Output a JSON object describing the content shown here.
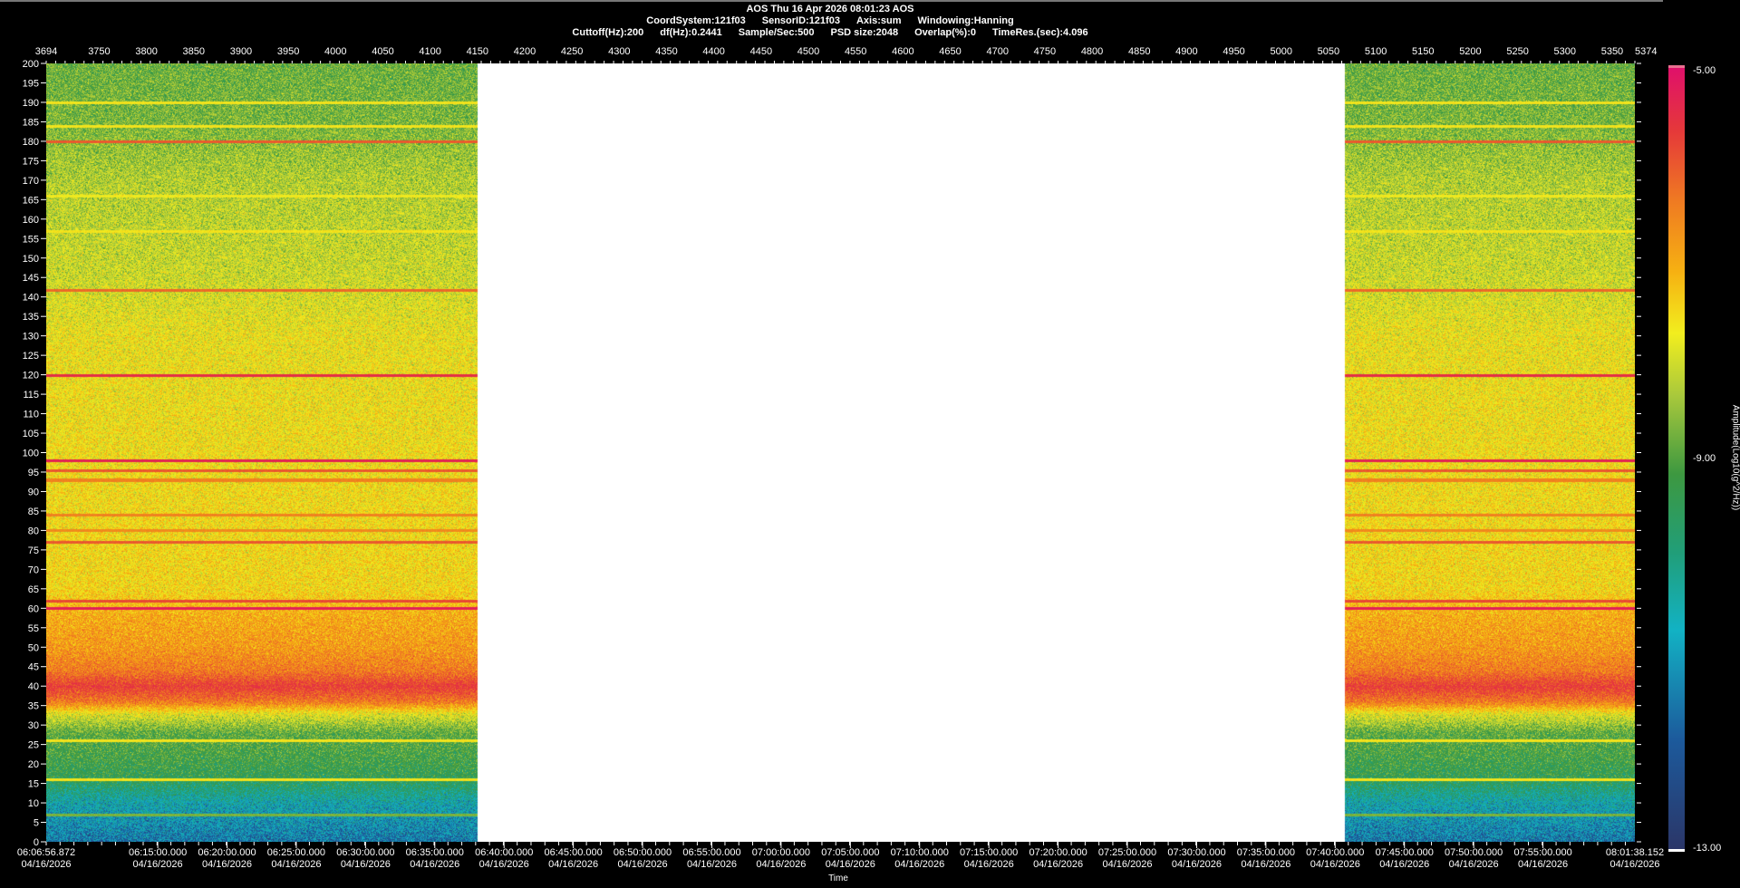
{
  "header": {
    "line1": "AOS  Thu 16 Apr 2026 08:01:23  AOS",
    "line2": [
      "CoordSystem:121f03",
      "SensorID:121f03",
      "Axis:sum",
      "Windowing:Hanning"
    ],
    "line3": [
      "Cuttoff(Hz):200",
      "df(Hz):0.2441",
      "Sample/Sec:500",
      "PSD size:2048",
      "Overlap(%):0",
      "TimeRes.(sec):4.096"
    ]
  },
  "chart_data": {
    "type": "heatmap",
    "title": "AOS  Thu 16 Apr 2026 08:01:23  AOS",
    "xlabel": "Time",
    "ylabel": "",
    "colorbar_label": "Amplitude(Log10(g^2/Hz))",
    "colorbar_range": [
      -13,
      -5
    ],
    "colorbar_ticks": [
      "-5.00",
      "-9.00",
      "-13.00"
    ],
    "y_range": [
      0,
      200
    ],
    "y_step": 5,
    "x_time_range_sec": [
      0,
      6881.28
    ],
    "x_start_label": [
      "06:06:56.872",
      "04/16/2026"
    ],
    "x_end_label": [
      "08:01:38.152",
      "04/16/2026"
    ],
    "x_tick_times": [
      "06:15:00.000",
      "06:20:00.000",
      "06:25:00.000",
      "06:30:00.000",
      "06:35:00.000",
      "06:40:00.000",
      "06:45:00.000",
      "06:50:00.000",
      "06:55:00.000",
      "07:00:00.000",
      "07:05:00.000",
      "07:10:00.000",
      "07:15:00.000",
      "07:20:00.000",
      "07:25:00.000",
      "07:30:00.000",
      "07:35:00.000",
      "07:40:00.000",
      "07:45:00.000",
      "07:50:00.000",
      "07:55:00.000"
    ],
    "x_tick_date": "04/16/2026",
    "top_axis_range": [
      3694,
      5374
    ],
    "top_axis_ticks": [
      3694,
      3750,
      3800,
      3850,
      3900,
      3950,
      4000,
      4050,
      4100,
      4150,
      4200,
      4250,
      4300,
      4350,
      4400,
      4450,
      4500,
      4550,
      4600,
      4650,
      4700,
      4750,
      4800,
      4850,
      4900,
      4950,
      5000,
      5050,
      5100,
      5150,
      5200,
      5250,
      5300,
      5350,
      5374
    ],
    "data_gap_sec": [
      1865,
      5625
    ],
    "mean_level_profile": [
      [
        0,
        -11.8
      ],
      [
        5,
        -11.5
      ],
      [
        10,
        -11.2
      ],
      [
        14,
        -10.6
      ],
      [
        17,
        -10.2
      ],
      [
        22,
        -10.0
      ],
      [
        28,
        -9.8
      ],
      [
        33,
        -8.8
      ],
      [
        36,
        -7.4
      ],
      [
        40,
        -6.6
      ],
      [
        44,
        -7.4
      ],
      [
        50,
        -7.8
      ],
      [
        58,
        -8.0
      ],
      [
        65,
        -8.5
      ],
      [
        100,
        -8.6
      ],
      [
        130,
        -8.7
      ],
      [
        145,
        -9.0
      ],
      [
        170,
        -9.2
      ],
      [
        185,
        -9.6
      ],
      [
        200,
        -9.7
      ]
    ],
    "harmonic_lines": [
      [
        190,
        -8.6
      ],
      [
        184,
        -8.6
      ],
      [
        180,
        -7.0
      ],
      [
        166,
        -8.7
      ],
      [
        157,
        -8.6
      ],
      [
        141.7,
        -7.2
      ],
      [
        120,
        -6.2
      ],
      [
        98,
        -5.8
      ],
      [
        95.5,
        -7.0
      ],
      [
        93,
        -7.5
      ],
      [
        84,
        -7.5
      ],
      [
        80,
        -7.6
      ],
      [
        77,
        -7.0
      ],
      [
        62,
        -6.8
      ],
      [
        60,
        -5.6
      ],
      [
        26,
        -8.6
      ],
      [
        16,
        -8.6
      ],
      [
        7,
        -9.6
      ]
    ]
  }
}
